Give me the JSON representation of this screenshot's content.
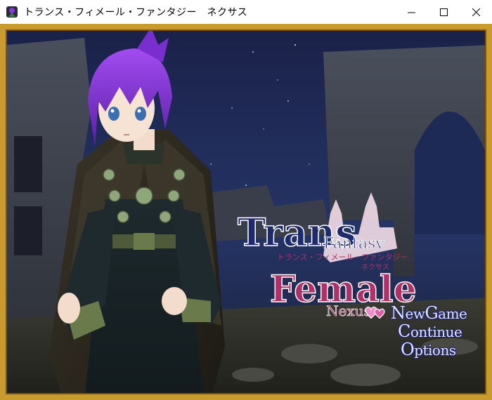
{
  "window": {
    "title": "トランス・フィメール・ファンタジー　ネクサス",
    "icon": "game-app-icon",
    "controls": [
      "minimize-icon",
      "maximize-icon",
      "close-icon"
    ]
  },
  "logo": {
    "line1": "Trans",
    "line1_sub": "Fantasy",
    "jp_line": "トランス・フィメール・ファンタジー",
    "jp_sub": "ネクサス",
    "line2": "Female",
    "line3": "Nexus"
  },
  "menu": {
    "items": [
      {
        "cap": "N",
        "rest": "ew",
        "cap2": "G",
        "rest2": "ame"
      },
      {
        "cap": "C",
        "rest": "ontinue"
      },
      {
        "cap": "O",
        "rest": "ptions"
      }
    ],
    "selected_index": 0,
    "cursor_icon": "heart-cursor-icon"
  },
  "colors": {
    "frame_gold": "#c99a2e",
    "sky": "#1b2550",
    "hair": "#8a35e0",
    "logo_navy": "#1d2a6b",
    "logo_pink": "#b0306a",
    "menu_text": "#dfe6ff"
  }
}
